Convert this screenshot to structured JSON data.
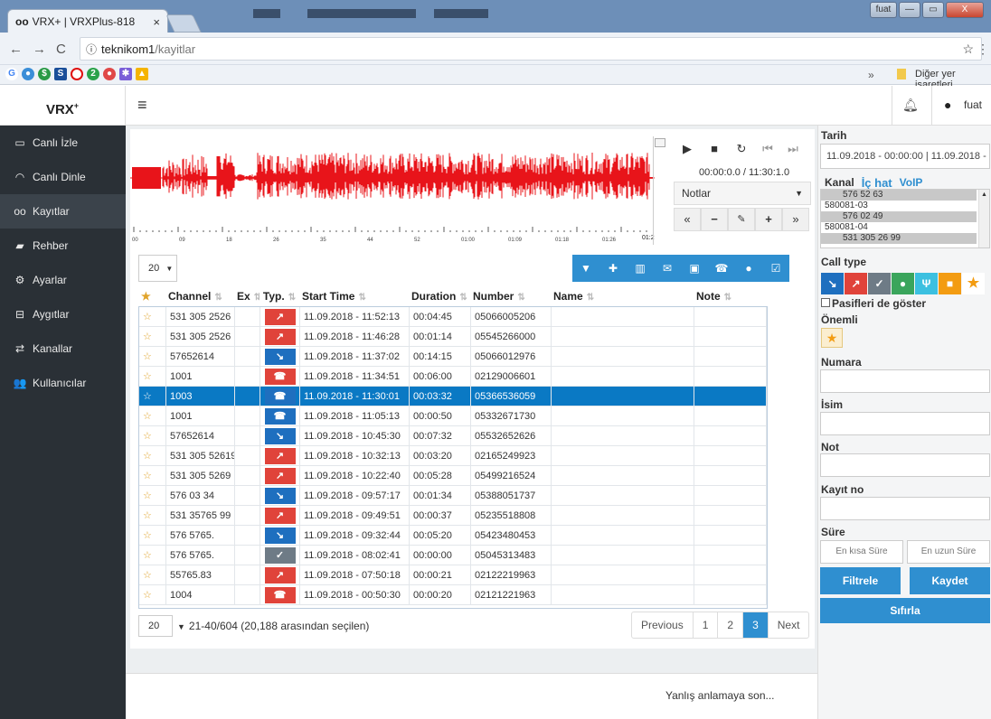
{
  "browser": {
    "tab_title": "VRX+ | VRXPlus-818",
    "tab_close": "×",
    "url_host": "teknikom1",
    "url_path": "/kayitlar",
    "bookmarks_more": "»",
    "bookmarks_other": "Diğer yer işaretleri",
    "window_user": "fuat",
    "win_min": "—",
    "win_max": "▭",
    "win_close": "X"
  },
  "app": {
    "brand": "VRX",
    "brand_sup": "+",
    "menu_icon": "≡",
    "user": "fuat"
  },
  "sidebar": {
    "items": [
      {
        "label": "Canlı İzle",
        "icon": "monitor-icon",
        "glyph": "▭"
      },
      {
        "label": "Canlı Dinle",
        "icon": "headphones-icon",
        "glyph": "◠"
      },
      {
        "label": "Kayıtlar",
        "icon": "voicemail-icon",
        "glyph": "oo"
      },
      {
        "label": "Rehber",
        "icon": "book-icon",
        "glyph": "▰"
      },
      {
        "label": "Ayarlar",
        "icon": "gears-icon",
        "glyph": "⚙"
      },
      {
        "label": "Aygıtlar",
        "icon": "hdd-icon",
        "glyph": "⊟"
      },
      {
        "label": "Kanallar",
        "icon": "exchange-icon",
        "glyph": "⇄"
      },
      {
        "label": "Kullanıcılar",
        "icon": "users-icon",
        "glyph": "👥"
      }
    ]
  },
  "player": {
    "time": "00:00:0.0 / 11:30:1.0",
    "notes_label": "Notlar",
    "time_ticks": [
      "00",
      "09",
      "18",
      "26",
      "35",
      "44",
      "52",
      "01:00",
      "01:09",
      "01:18",
      "01:26"
    ],
    "end_tick": "01:2"
  },
  "toolbar": {
    "page_size": "20",
    "icons": [
      "filter-icon",
      "user-plus-icon",
      "trash-icon",
      "envelope-icon",
      "save-icon",
      "phone-square-icon",
      "user-icon",
      "check-square-icon"
    ]
  },
  "table": {
    "headers": [
      "",
      "Channel",
      "Ex",
      "Typ.",
      "Start Time",
      "Duration",
      "Number",
      "Name",
      "Note"
    ],
    "rows": [
      {
        "channel": "531 305 2526",
        "type": "out",
        "start": "11.09.2018 - 11:52:13",
        "duration": "00:04:45",
        "number": "05066005206"
      },
      {
        "channel": "531 305 2526",
        "type": "out",
        "start": "11.09.2018 - 11:46:28",
        "duration": "00:01:14",
        "number": "05545266000"
      },
      {
        "channel": "57652614",
        "type": "in",
        "start": "11.09.2018 - 11:37:02",
        "duration": "00:14:15",
        "number": "05066012976"
      },
      {
        "channel": "1001",
        "type": "int",
        "start": "11.09.2018 - 11:34:51",
        "duration": "00:06:00",
        "number": "02129006601"
      },
      {
        "channel": "1003",
        "type": "int2",
        "start": "11.09.2018 - 11:30:01",
        "duration": "00:03:32",
        "number": "05366536059",
        "selected": true
      },
      {
        "channel": "1001",
        "type": "int2",
        "start": "11.09.2018 - 11:05:13",
        "duration": "00:00:50",
        "number": "05332671730"
      },
      {
        "channel": "57652614",
        "type": "in",
        "start": "11.09.2018 - 10:45:30",
        "duration": "00:07:32",
        "number": "05532652626"
      },
      {
        "channel": "531 305 52619",
        "type": "out",
        "start": "11.09.2018 - 10:32:13",
        "duration": "00:03:20",
        "number": "02165249923"
      },
      {
        "channel": "531 305 5269",
        "type": "out",
        "start": "11.09.2018 - 10:22:40",
        "duration": "00:05:28",
        "number": "05499216524"
      },
      {
        "channel": "576 03 34",
        "type": "in",
        "start": "11.09.2018 - 09:57:17",
        "duration": "00:01:34",
        "number": "05388051737"
      },
      {
        "channel": "531 35765 99",
        "type": "out",
        "start": "11.09.2018 - 09:49:51",
        "duration": "00:00:37",
        "number": "05235518808"
      },
      {
        "channel": "576 5765.",
        "type": "in",
        "start": "11.09.2018 - 09:32:44",
        "duration": "00:05:20",
        "number": "05423480453"
      },
      {
        "channel": "576 5765.",
        "type": "miss",
        "start": "11.09.2018 - 08:02:41",
        "duration": "00:00:00",
        "number": "05045313483"
      },
      {
        "channel": "55765.83",
        "type": "out",
        "start": "11.09.2018 - 07:50:18",
        "duration": "00:00:21",
        "number": "02122219963"
      },
      {
        "channel": "1004",
        "type": "int",
        "start": "11.09.2018 - 00:50:30",
        "duration": "00:00:20",
        "number": "02121221963"
      }
    ]
  },
  "pagination": {
    "page_size": "20",
    "summary": "21-40/604 (20,188 arasından seçilen)",
    "prev": "Previous",
    "pages": [
      "1",
      "2",
      "3"
    ],
    "current": "3",
    "next": "Next"
  },
  "filters": {
    "date_label": "Tarih",
    "date_value": "11.09.2018 - 00:00:00 | 11.09.2018 - 23:59",
    "tabs": [
      "Kanal",
      "İç hat",
      "VoIP"
    ],
    "channels": [
      "576 52 63",
      "580081-03",
      "576 02 49",
      "580081-04",
      "531 305 26 99"
    ],
    "calltype_label": "Call type",
    "passive_label": "Pasifleri de göster",
    "important_label": "Önemli",
    "number_label": "Numara",
    "name_label": "İsim",
    "note_label": "Not",
    "record_label": "Kayıt no",
    "duration_label": "Süre",
    "min_placeholder": "En kısa Süre",
    "max_placeholder": "En uzun Süre",
    "filter_btn": "Filtrele",
    "save_btn": "Kaydet",
    "reset_btn": "Sıfırla"
  },
  "footer": {
    "text": "Yanlış anlamaya son..."
  },
  "colors": {
    "accent": "#2f8fd0",
    "out": "#e0433a",
    "in": "#1e6fbf",
    "missed": "#6e7b86",
    "sidebar": "#2a3036",
    "wave": "#e8141a"
  }
}
